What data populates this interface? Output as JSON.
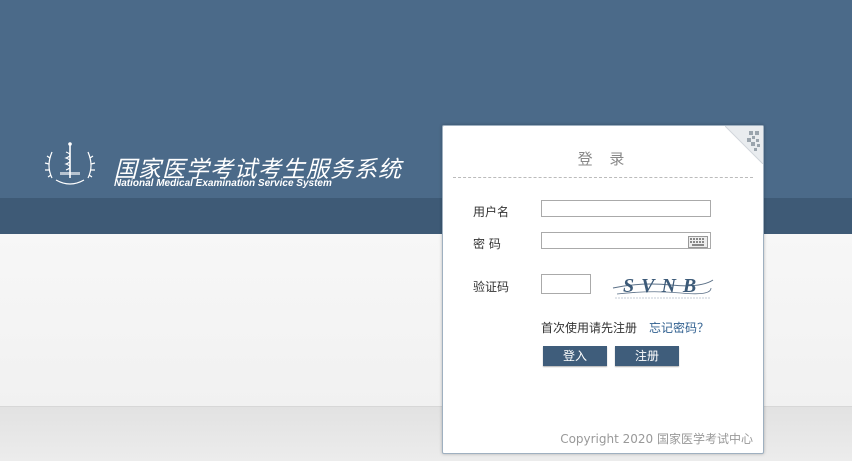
{
  "header": {
    "title": "国家医学考试考生服务系统",
    "subtitle": "National Medical Examination Service System"
  },
  "login": {
    "title": "登 录",
    "username_label": "用户名",
    "username_value": "",
    "password_label": "密 码",
    "password_value": "",
    "captcha_label": "验证码",
    "captcha_value": "",
    "captcha_text": "SVNB",
    "register_hint": "首次使用请先注册",
    "forgot_link": "忘记密码？",
    "login_button": "登入",
    "register_button": "注册",
    "copyright": "Copyright 2020 国家医学考试中心"
  },
  "colors": {
    "header_bg": "#4b6a89",
    "header_band": "#3e5a76",
    "button_bg": "#3f5d7b",
    "link": "#2f5f8f"
  },
  "icons": [
    "logo-emblem",
    "qr-code-icon",
    "keyboard-icon"
  ]
}
